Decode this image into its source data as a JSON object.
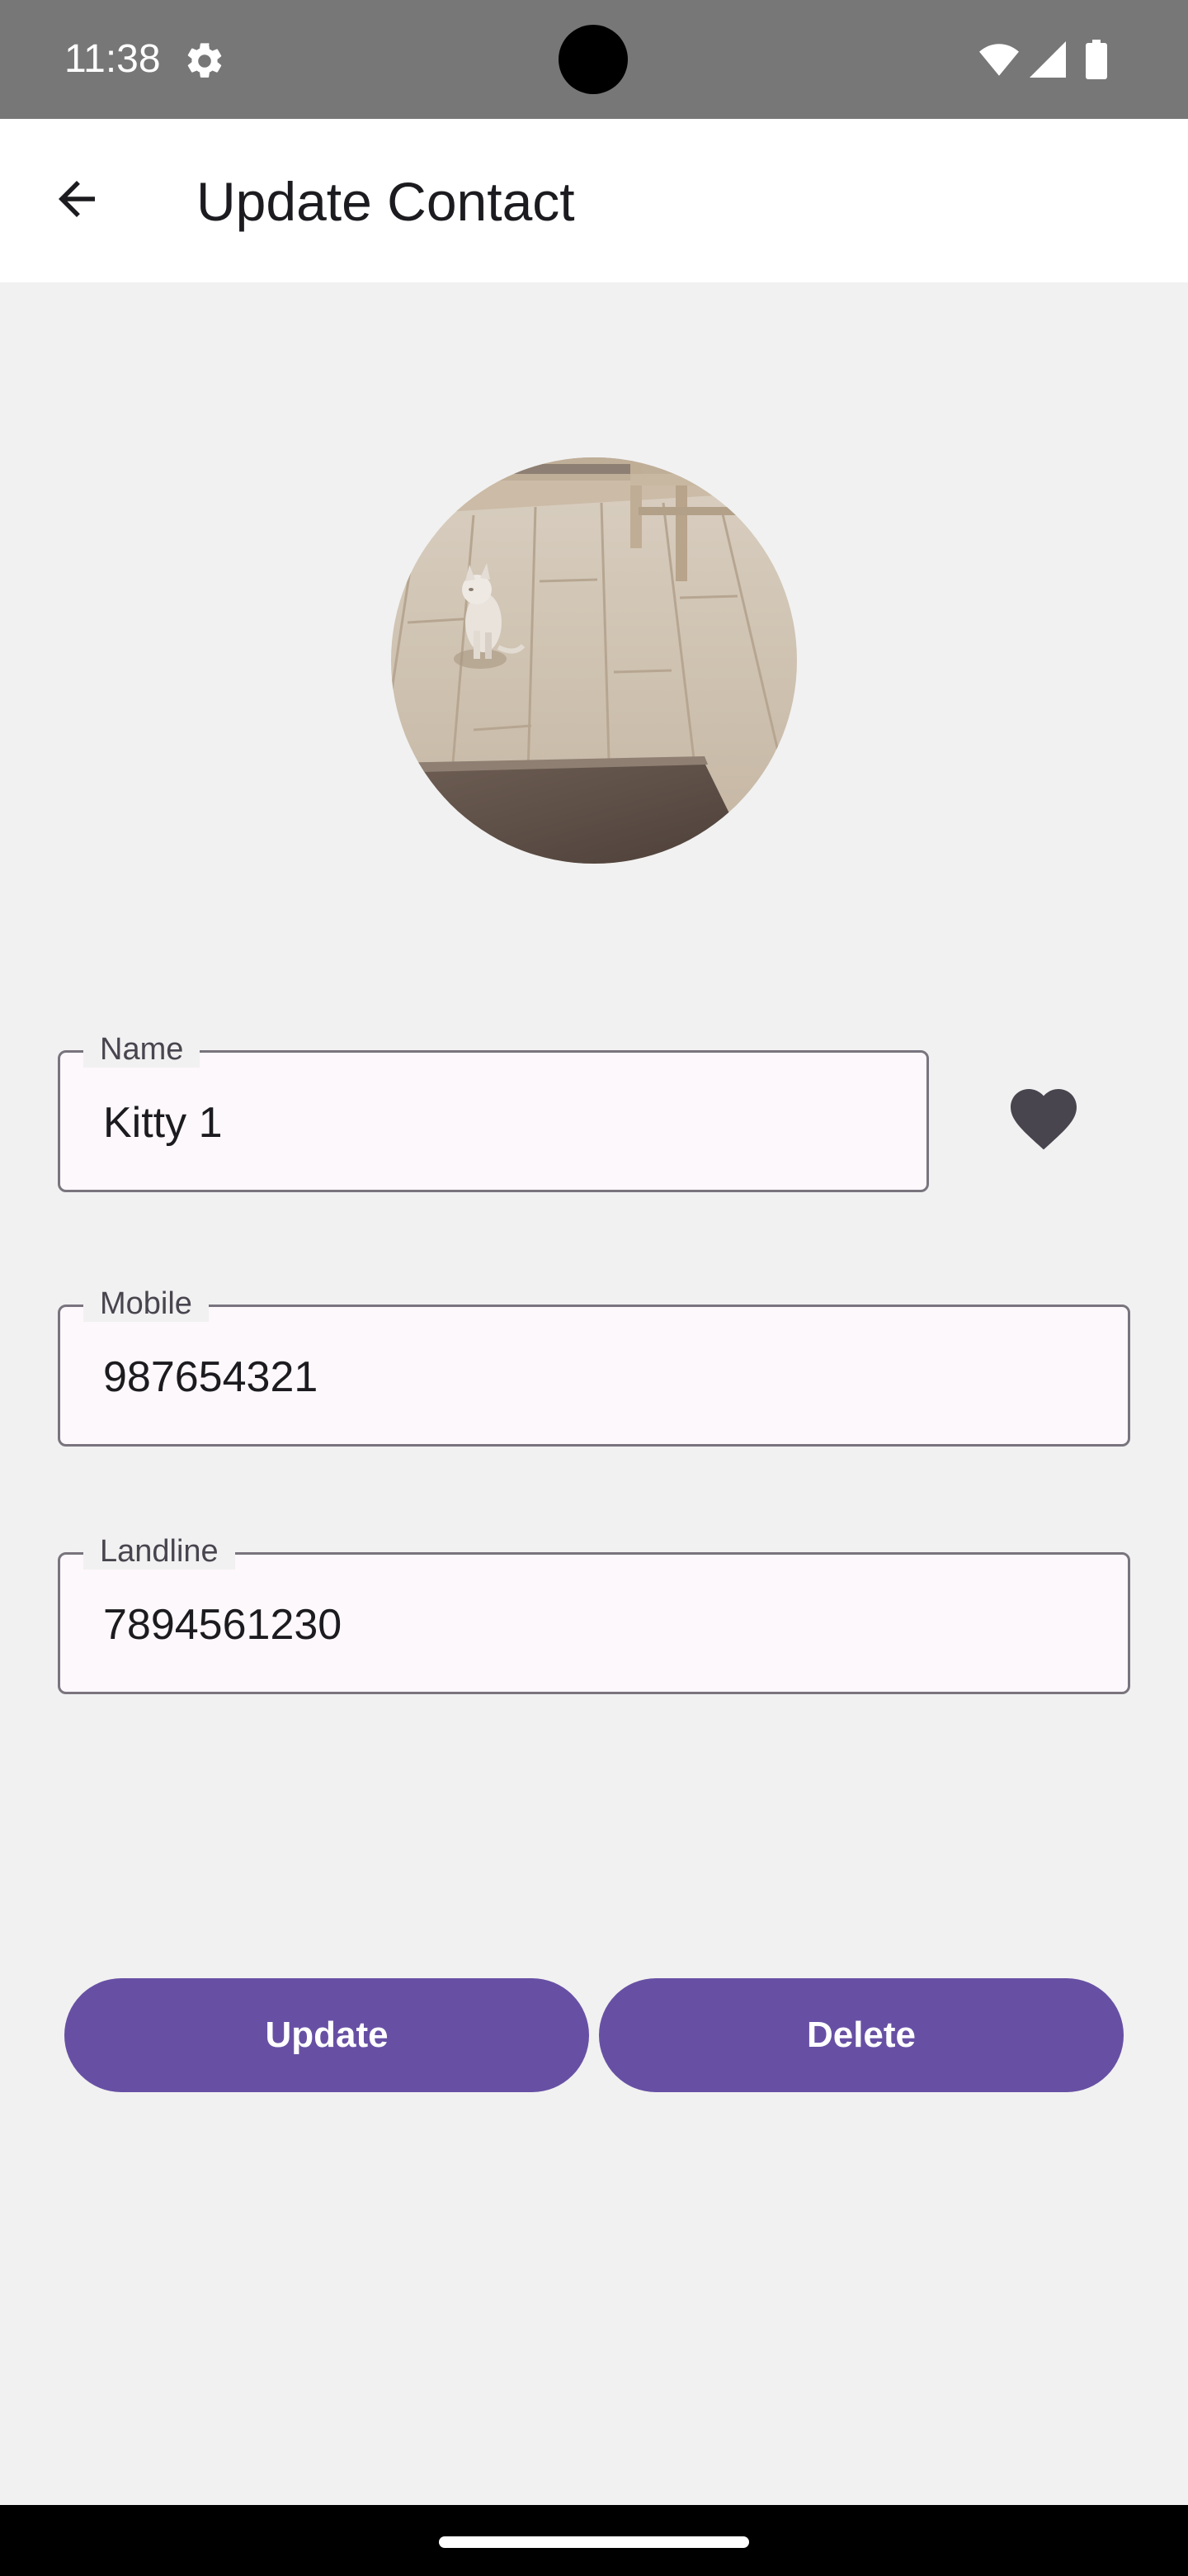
{
  "status_bar": {
    "time": "11:38",
    "icons": [
      "settings-gear-icon",
      "wifi-icon",
      "cell-signal-icon",
      "battery-icon"
    ]
  },
  "app_bar": {
    "title": "Update Contact",
    "back_icon": "arrow-left-icon"
  },
  "contact": {
    "avatar": "cat-photo",
    "fields": {
      "name": {
        "label": "Name",
        "value": "Kitty 1"
      },
      "mobile": {
        "label": "Mobile",
        "value": "987654321"
      },
      "landline": {
        "label": "Landline",
        "value": "7894561230"
      }
    },
    "favorite_icon": "heart-filled-icon"
  },
  "actions": {
    "update_label": "Update",
    "delete_label": "Delete"
  },
  "colors": {
    "primary": "#6750a4",
    "background": "#f1f1f1",
    "status_bar": "#777777",
    "heart": "#49454f"
  }
}
